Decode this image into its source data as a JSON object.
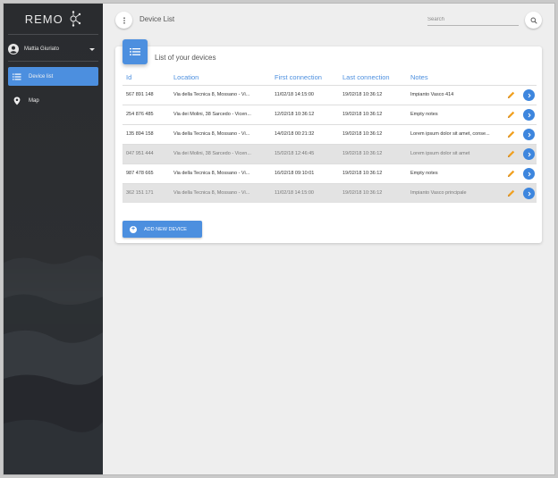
{
  "app": {
    "logo_text": "REMO"
  },
  "sidebar": {
    "user_name": "Mattia Giuriato",
    "items": [
      {
        "label": "Device list",
        "icon": "list-icon",
        "active": true
      },
      {
        "label": "Map",
        "icon": "map-pin-icon",
        "active": false
      }
    ]
  },
  "header": {
    "title": "Device List",
    "search_placeholder": "Search"
  },
  "card": {
    "title": "List of your devices",
    "columns": [
      "Id",
      "Location",
      "First connection",
      "Last connection",
      "Notes"
    ],
    "rows": [
      {
        "id": "567 891 148",
        "location": "Via della Tecnica 8, Mossano - Vi...",
        "first": "11/02/18 14:15:00",
        "last": "19/02/18 10:36:12",
        "notes": "Impianto Vasco 414",
        "disabled": false
      },
      {
        "id": "254 876 485",
        "location": "Via dei Molini, 38 Sarcedo - Vicen...",
        "first": "12/02/18 10:36:12",
        "last": "19/02/18 10:36:12",
        "notes": "Empty notes",
        "disabled": false
      },
      {
        "id": "135 894 158",
        "location": "Via della Tecnica 8, Mossano - Vi...",
        "first": "14/02/18 00:21:32",
        "last": "19/02/18 10:36:12",
        "notes": "Lorem ipsum dolor sit amet, conse...",
        "disabled": false
      },
      {
        "id": "047 951 444",
        "location": "Via dei Molini, 38 Sarcedo - Vicen...",
        "first": "15/02/18 12:46:45",
        "last": "19/02/18 10:36:12",
        "notes": "Lorem ipsum dolor sit amet",
        "disabled": true
      },
      {
        "id": "987 478 665",
        "location": "Via della Tecnica 8, Mossano - Vi...",
        "first": "16/02/18 09:10:01",
        "last": "19/02/18 10:36:12",
        "notes": "Empty notes",
        "disabled": false
      },
      {
        "id": "362 151 171",
        "location": "Via della Tecnica 8, Mossano - Vi...",
        "first": "11/02/18 14:15:00",
        "last": "19/02/18 10:36:12",
        "notes": "Impianto Vasco principale",
        "disabled": true
      }
    ],
    "add_button_label": "ADD NEW DEVICE"
  },
  "colors": {
    "accent": "#4c8fdf",
    "edit": "#f0a020",
    "sidebar_bg": "#2a2c2f"
  }
}
